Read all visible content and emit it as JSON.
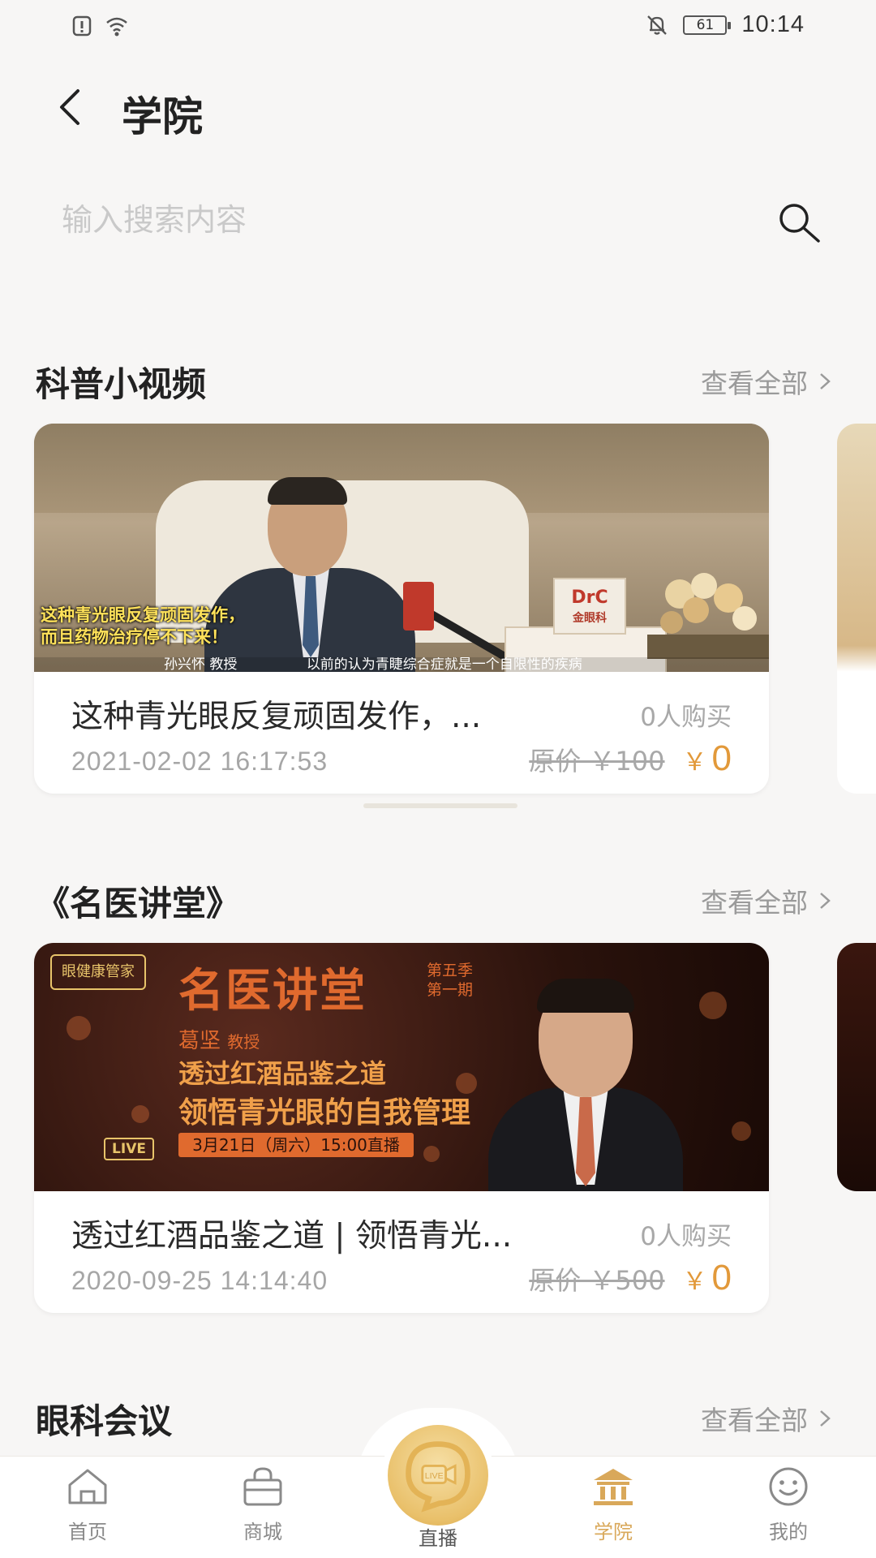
{
  "status_bar": {
    "battery": "61",
    "time": "10:14"
  },
  "header": {
    "title": "学院"
  },
  "search": {
    "placeholder": "输入搜索内容"
  },
  "sections": [
    {
      "title": "科普小视频",
      "view_all": "查看全部",
      "card": {
        "title": "这种青光眼反复顽固发作，...",
        "buyers": "0人购买",
        "date": "2021-02-02 16:17:53",
        "original_price": "原价 ￥100",
        "currency": "￥",
        "price": "0",
        "thumb_caption_line1": "这种青光眼反复顽固发作，",
        "thumb_caption_line2": "而且药物治疗停不下来！",
        "thumb_speaker": "孙兴怀 教授",
        "thumb_subtitle": "以前的认为青睫综合症就是一个自限性的疾病",
        "thumb_brand": "DrC",
        "thumb_brand_name": "金眼科"
      }
    },
    {
      "title": "《名医讲堂》",
      "view_all": "查看全部",
      "card": {
        "title": "透过红酒品鉴之道 | 领悟青光...",
        "buyers": "0人购买",
        "date": "2020-09-25 14:14:40",
        "original_price": "原价 ￥500",
        "currency": "￥",
        "price": "0",
        "thumb_logo": "眼健康管家",
        "thumb_heading": "名医讲堂",
        "thumb_season_1": "第五季",
        "thumb_season_2": "第一期",
        "thumb_doctor": "葛坚",
        "thumb_doctor_title": "教授",
        "thumb_line1": "透过红酒品鉴之道",
        "thumb_line2": "领悟青光眼的自我管理",
        "thumb_live": "LIVE",
        "thumb_schedule": "3月21日（周六）15:00直播"
      }
    },
    {
      "title": "眼科会议",
      "view_all": "查看全部"
    }
  ],
  "bottom_nav": {
    "items": [
      {
        "label": "首页",
        "icon": "home-icon"
      },
      {
        "label": "商城",
        "icon": "shop-bag-icon"
      },
      {
        "label": "直播",
        "icon": "live-camera-icon"
      },
      {
        "label": "学院",
        "icon": "academy-icon",
        "active": true
      },
      {
        "label": "我的",
        "icon": "smiley-icon"
      }
    ]
  },
  "colors": {
    "accent": "#d9a85a",
    "price": "#e2993a",
    "muted": "#a8a8a8"
  }
}
